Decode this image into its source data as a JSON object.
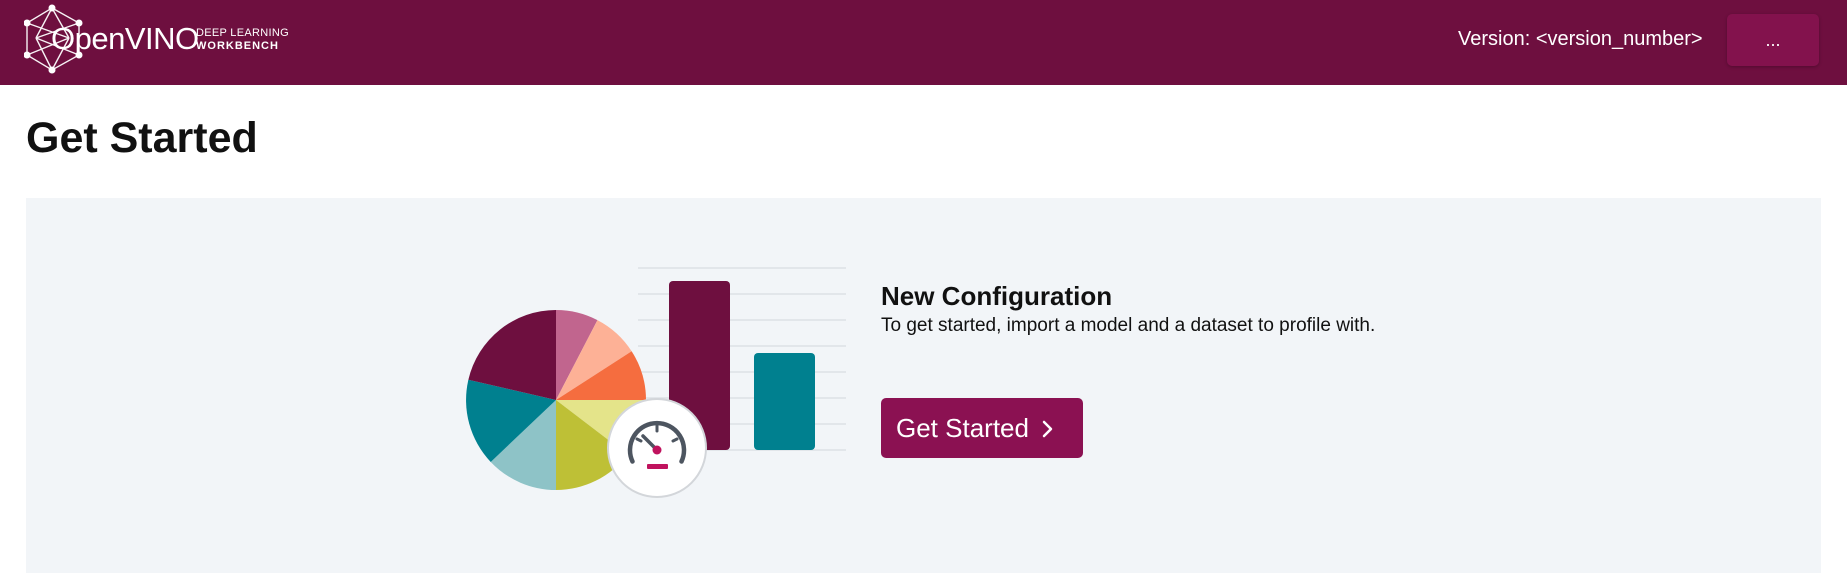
{
  "header": {
    "brand": "OpenVINO",
    "brand_tm": "™",
    "brand_sub_line1": "DEEP LEARNING",
    "brand_sub_line2": "WORKBENCH",
    "version_text": "Version: <version_number>",
    "menu_label": "..."
  },
  "page": {
    "title": "Get Started"
  },
  "card": {
    "title": "New Configuration",
    "description": "To get started, import a model and a dataset to profile with.",
    "button_label": "Get Started",
    "button_icon": "chevron-right-icon"
  },
  "illustration": {
    "icons": [
      "pie-chart",
      "bar-chart",
      "speedometer-icon"
    ],
    "colors": {
      "brand_dark": "#6e0f3f",
      "button": "#8b1152",
      "teal": "#00808f",
      "light_teal": "#8ec3c7",
      "olive": "#bec036",
      "pale_yellow": "#e4e48a",
      "orange": "#f56d3f",
      "peach": "#fdb196",
      "mauve": "#c1658e",
      "panel_bg": "#f2f5f8"
    }
  }
}
